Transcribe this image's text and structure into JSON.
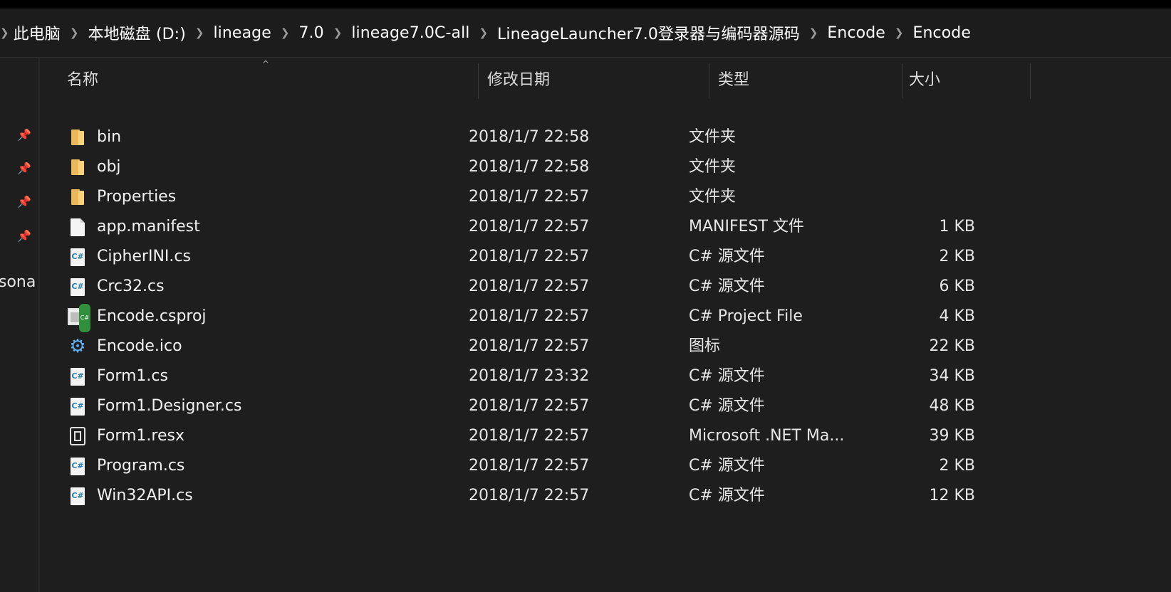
{
  "breadcrumb": {
    "items": [
      "此电脑",
      "本地磁盘 (D:)",
      "lineage",
      "7.0",
      "lineage7.0C-all",
      "LineageLauncher7.0登录器与编码器源码",
      "Encode",
      "Encode"
    ]
  },
  "nav": {
    "partial_label": "sona"
  },
  "columns": {
    "name": "名称",
    "date": "修改日期",
    "type": "类型",
    "size": "大小"
  },
  "files": [
    {
      "icon": "folder-icon",
      "name": "bin",
      "date": "2018/1/7 22:58",
      "type": "文件夹",
      "size": ""
    },
    {
      "icon": "folder-icon",
      "name": "obj",
      "date": "2018/1/7 22:58",
      "type": "文件夹",
      "size": ""
    },
    {
      "icon": "folder-icon",
      "name": "Properties",
      "date": "2018/1/7 22:57",
      "type": "文件夹",
      "size": ""
    },
    {
      "icon": "file-icon",
      "name": "app.manifest",
      "date": "2018/1/7 22:57",
      "type": "MANIFEST 文件",
      "size": "1 KB"
    },
    {
      "icon": "csharp-file-icon",
      "name": "CipherINI.cs",
      "date": "2018/1/7 22:57",
      "type": "C# 源文件",
      "size": "2 KB"
    },
    {
      "icon": "csharp-file-icon",
      "name": "Crc32.cs",
      "date": "2018/1/7 22:57",
      "type": "C# 源文件",
      "size": "6 KB"
    },
    {
      "icon": "csproj-icon",
      "name": "Encode.csproj",
      "date": "2018/1/7 22:57",
      "type": "C# Project File",
      "size": "4 KB"
    },
    {
      "icon": "gear-icon",
      "name": "Encode.ico",
      "date": "2018/1/7 22:57",
      "type": "图标",
      "size": "22 KB"
    },
    {
      "icon": "csharp-file-icon",
      "name": "Form1.cs",
      "date": "2018/1/7 23:32",
      "type": "C# 源文件",
      "size": "34 KB"
    },
    {
      "icon": "csharp-file-icon",
      "name": "Form1.Designer.cs",
      "date": "2018/1/7 22:57",
      "type": "C# 源文件",
      "size": "48 KB"
    },
    {
      "icon": "resx-icon",
      "name": "Form1.resx",
      "date": "2018/1/7 22:57",
      "type": "Microsoft .NET Ma...",
      "size": "39 KB"
    },
    {
      "icon": "csharp-file-icon",
      "name": "Program.cs",
      "date": "2018/1/7 22:57",
      "type": "C# 源文件",
      "size": "2 KB"
    },
    {
      "icon": "csharp-file-icon",
      "name": "Win32API.cs",
      "date": "2018/1/7 22:57",
      "type": "C# 源文件",
      "size": "12 KB"
    }
  ],
  "colors": {
    "background": "#1e1e1e",
    "text": "#ffffff",
    "folder": "#e8b85a",
    "gear": "#5fb0f5"
  }
}
